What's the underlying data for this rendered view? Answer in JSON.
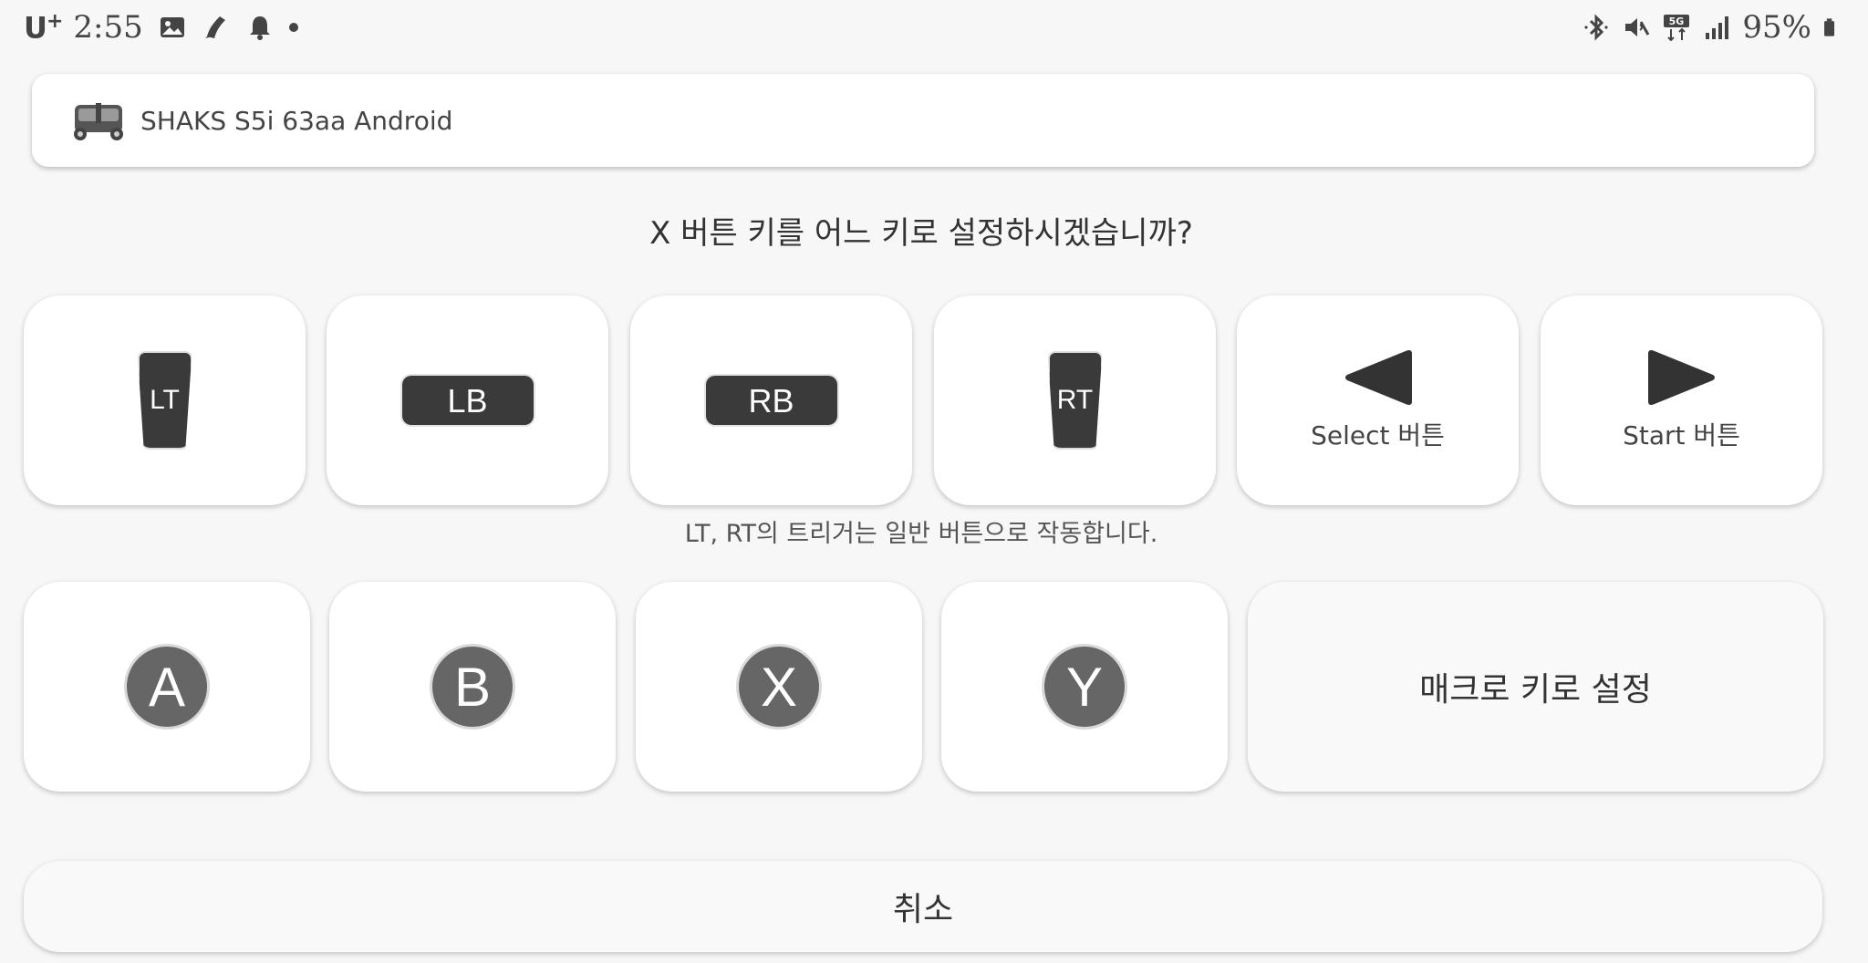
{
  "status_bar": {
    "carrier": "U",
    "carrier_sup": "+",
    "time": "2:55",
    "battery_percent": "95%",
    "left_icons": [
      "image-icon",
      "app-notification-icon",
      "bell-icon",
      "dot-icon"
    ],
    "right_icons": [
      "bluetooth-icon",
      "mute-icon",
      "5g-icon",
      "signal-icon",
      "battery-icon"
    ]
  },
  "device": {
    "icon": "gamepad-icon",
    "name": "SHAKS S5i 63aa Android"
  },
  "prompt": {
    "question": "X 버튼 키를 어느 키로 설정하시겠습니까?",
    "trigger_note": "LT, RT의 트리거는 일반 버튼으로 작동합니다."
  },
  "keys_row1": [
    {
      "id": "lt",
      "label": "LT"
    },
    {
      "id": "lb",
      "label": "LB"
    },
    {
      "id": "rb",
      "label": "RB"
    },
    {
      "id": "rt",
      "label": "RT"
    },
    {
      "id": "select",
      "label": "Select 버튼"
    },
    {
      "id": "start",
      "label": "Start 버튼"
    }
  ],
  "keys_row2": [
    {
      "id": "a",
      "label": "A"
    },
    {
      "id": "b",
      "label": "B"
    },
    {
      "id": "x",
      "label": "X"
    },
    {
      "id": "y",
      "label": "Y"
    }
  ],
  "macro": {
    "label": "매크로 키로 설정"
  },
  "cancel": {
    "label": "취소"
  },
  "colors": {
    "background": "#f7f7f7",
    "card": "#ffffff",
    "key_dark": "#3a3a3a",
    "face_button": "#666666",
    "text": "#333333"
  }
}
